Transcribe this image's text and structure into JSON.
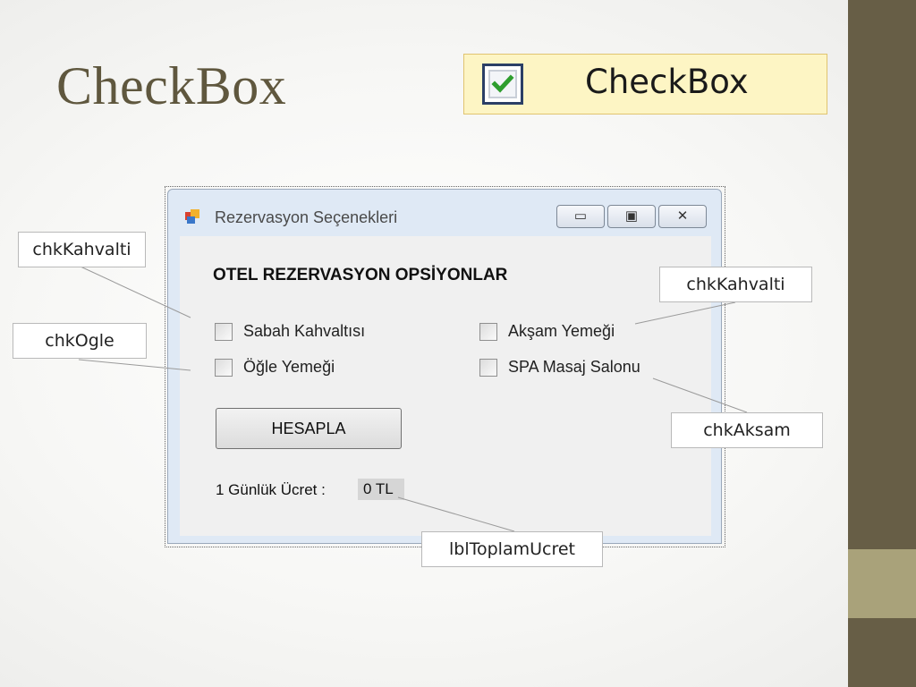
{
  "slide": {
    "title": "CheckBox",
    "demo_label": "CheckBox"
  },
  "form": {
    "window_title": "Rezervasyon Seçenekleri",
    "controls": {
      "minimize": "▭",
      "maximize": "▣",
      "close": "✕"
    },
    "heading": "OTEL REZERVASYON OPSİYONLAR",
    "checkboxes": [
      {
        "label": "Sabah Kahvaltısı",
        "checked": false
      },
      {
        "label": "Öğle Yemeği",
        "checked": false
      },
      {
        "label": "Akşam Yemeği",
        "checked": false
      },
      {
        "label": "SPA Masaj Salonu",
        "checked": false
      }
    ],
    "button_label": "HESAPLA",
    "fee_label": "1 Günlük Ücret :",
    "fee_value": "0 TL"
  },
  "callouts": {
    "left_top": "chkKahvalti",
    "left_bottom": "chkOgle",
    "right_top": "chkKahvalti",
    "right_bottom": "chkAksam",
    "bottom": "lblToplamUcret"
  },
  "colors": {
    "title": "#5f573e",
    "sidebar": "#675e46",
    "sidebar_accent": "#a9a27a",
    "demo_background": "#fdf5c4",
    "check_mark": "#2e9e2e"
  }
}
